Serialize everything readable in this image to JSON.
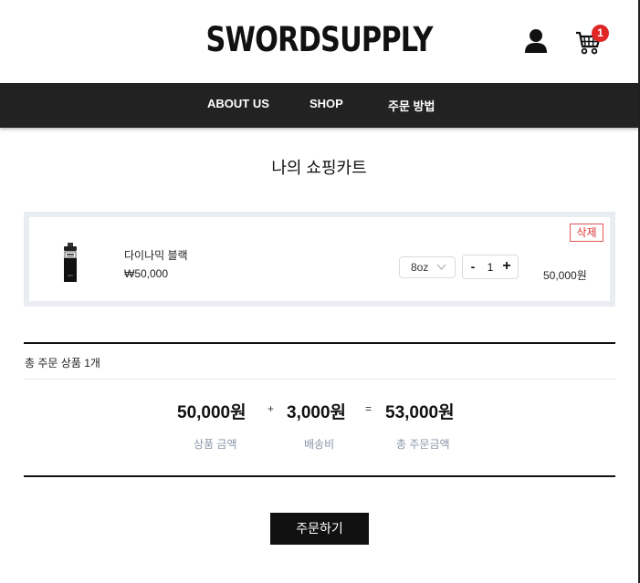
{
  "header": {
    "logo": "SWORDSUPPLY",
    "user_icon": "user-icon",
    "cart_icon": "cart-icon",
    "cart_count": "1"
  },
  "nav": {
    "items": [
      "ABOUT US",
      "SHOP",
      "주문 방법"
    ]
  },
  "page_title": "나의 쇼핑카트",
  "cart": {
    "items": [
      {
        "name": "다이나믹 블랙",
        "price": "₩50,000",
        "option": "8oz",
        "quantity": "1",
        "minus": "-",
        "plus": "+",
        "total": "50,000원",
        "delete_label": "삭제"
      }
    ]
  },
  "summary": {
    "count_text": "총 주문 상품 1개",
    "product_amount": "50,000원",
    "product_label": "상품 금액",
    "plus": "+",
    "shipping_amount": "3,000원",
    "shipping_label": "배송비",
    "equals": "=",
    "total_amount": "53,000원",
    "total_label": "총 주문금액"
  },
  "order_button": "주문하기",
  "colors": {
    "nav_bg": "#222222",
    "badge": "#e02525",
    "delete": "#d33333",
    "label": "#8a94a8",
    "cart_bg": "#e9edf1"
  }
}
